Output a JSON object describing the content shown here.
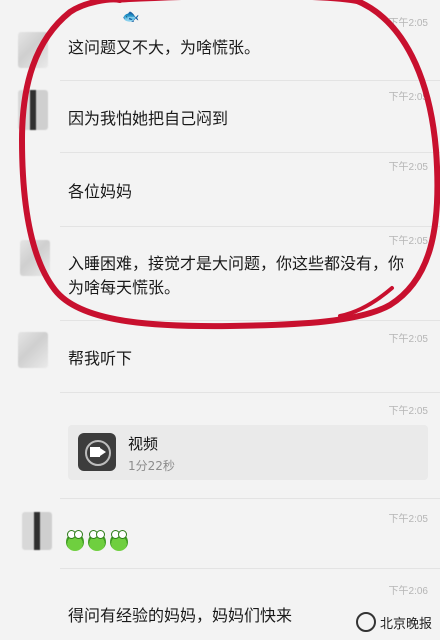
{
  "messages": [
    {
      "time": "下午2:05",
      "text": "这问题又不大，为啥慌张。"
    },
    {
      "time": "下午2:05",
      "text": "因为我怕她把自己闷到"
    },
    {
      "time": "下午2:05",
      "text": "各位妈妈"
    },
    {
      "time": "下午2:05",
      "text": "入睡困难，接觉才是大问题，你这些都没有，你为啥每天慌张。"
    },
    {
      "time": "下午2:05",
      "text": "帮我听下"
    },
    {
      "time": "下午2:05",
      "video": {
        "title": "视频",
        "duration": "1分22秒"
      }
    },
    {
      "time": "下午2:05",
      "emoji": [
        "frog",
        "frog",
        "frog"
      ]
    },
    {
      "time": "下午2:06",
      "text": "得问有经验的妈妈，妈妈们快来"
    }
  ],
  "watermark": {
    "text": "北京晚报"
  },
  "colors": {
    "annotation": "#c8102e",
    "background": "#f3f3f3",
    "timestamp": "#b5b5b5"
  }
}
